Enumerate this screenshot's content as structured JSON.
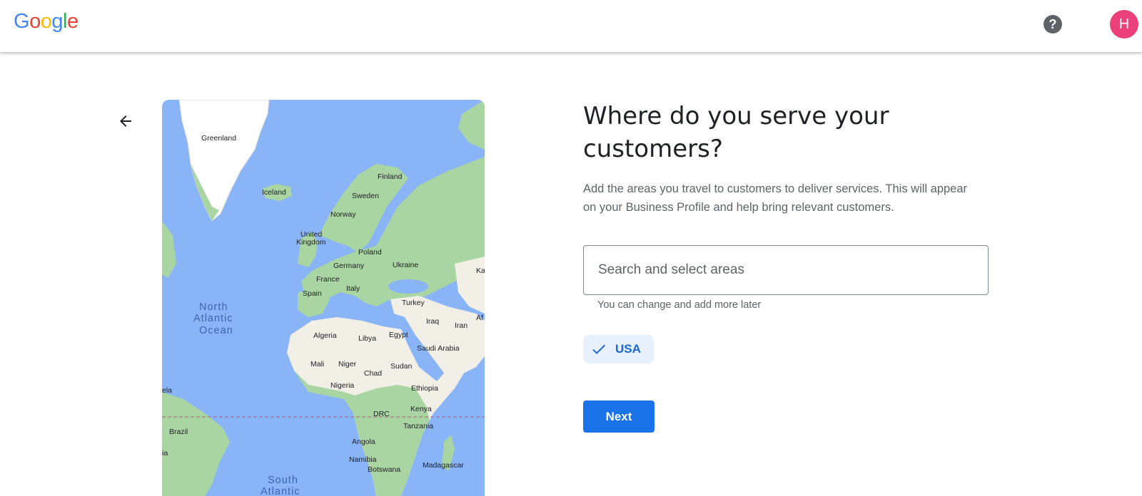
{
  "header": {
    "logo_letters": [
      {
        "char": "G",
        "color": "#4285F4"
      },
      {
        "char": "o",
        "color": "#EA4335"
      },
      {
        "char": "o",
        "color": "#FBBC05"
      },
      {
        "char": "g",
        "color": "#4285F4"
      },
      {
        "char": "l",
        "color": "#34A853"
      },
      {
        "char": "e",
        "color": "#EA4335"
      }
    ],
    "help_icon": "help-circle-icon",
    "help_glyph": "?",
    "avatar_initial": "H",
    "avatar_color": "#EC407A"
  },
  "back_icon": "arrow-left-icon",
  "map": {
    "labels": {
      "greenland": "Greenland",
      "iceland": "Iceland",
      "finland": "Finland",
      "sweden": "Sweden",
      "norway": "Norway",
      "united": "United",
      "kingdom": "Kingdom",
      "poland": "Poland",
      "germany": "Germany",
      "ukraine": "Ukraine",
      "ka": "Ka",
      "france": "France",
      "spain": "Spain",
      "italy": "Italy",
      "turkey": "Turkey",
      "af": "Af",
      "iraq": "Iraq",
      "iran": "Iran",
      "algeria": "Algeria",
      "libya": "Libya",
      "egypt": "Egypt",
      "saudi_arabia": "Saudi Arabia",
      "mali": "Mali",
      "niger": "Niger",
      "sudan": "Sudan",
      "chad": "Chad",
      "nigeria": "Nigeria",
      "ethiopia": "Ethiopia",
      "ela": "ela",
      "drc": "DRC",
      "kenya": "Kenya",
      "tanzania": "Tanzania",
      "brazil": "Brazil",
      "angola": "Angola",
      "ia": "ia",
      "namibia": "Namibia",
      "botswana": "Botswana",
      "madagascar": "Madagascar",
      "north": "North",
      "atlantic": "Atlantic",
      "ocean": "Ocean",
      "south": "South",
      "south_atlantic": "Atlantic"
    },
    "colors": {
      "water": "#8AB4F8",
      "land": "#F2EFE6",
      "vegetation": "#A8D5A2",
      "ice": "#FFFFFF",
      "equator": "#B35A7A"
    }
  },
  "content": {
    "title": "Where do you serve your customers?",
    "description": "Add the areas you travel to customers to deliver services. This will appear on your Business Profile and help bring relevant customers.",
    "search_placeholder": "Search and select areas",
    "search_value": "",
    "hint": "You can change and add more later",
    "chip_label": "USA",
    "chip_icon": "checkmark-icon",
    "next_label": "Next",
    "accent_color": "#1A73E8"
  }
}
